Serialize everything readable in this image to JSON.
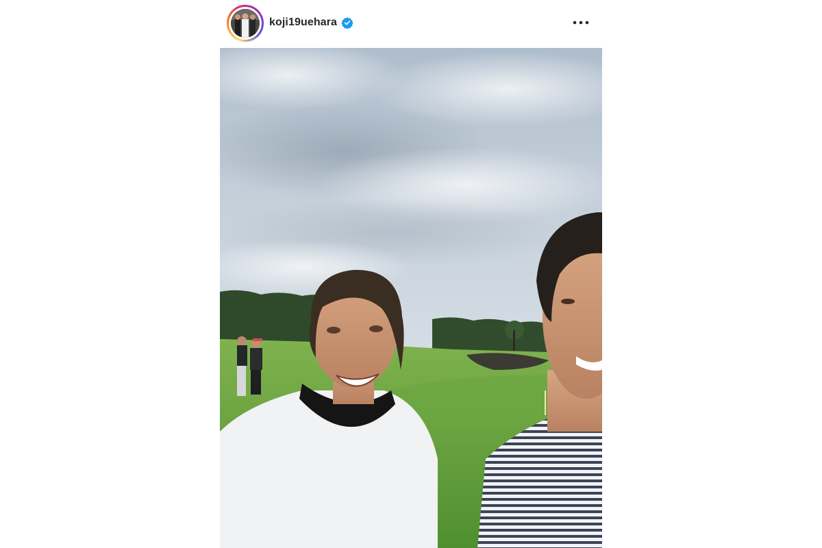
{
  "post": {
    "username": "koji19uehara",
    "verified": true,
    "avatar_icon": "profile-photo",
    "more_icon": "more-options-icon"
  },
  "photo": {
    "description_icon": "post-photo"
  },
  "colors": {
    "text": "#262626",
    "verified_blue": "#1d9bf0",
    "sky": "#c9d3dc",
    "grass": "#5f9e3b"
  }
}
